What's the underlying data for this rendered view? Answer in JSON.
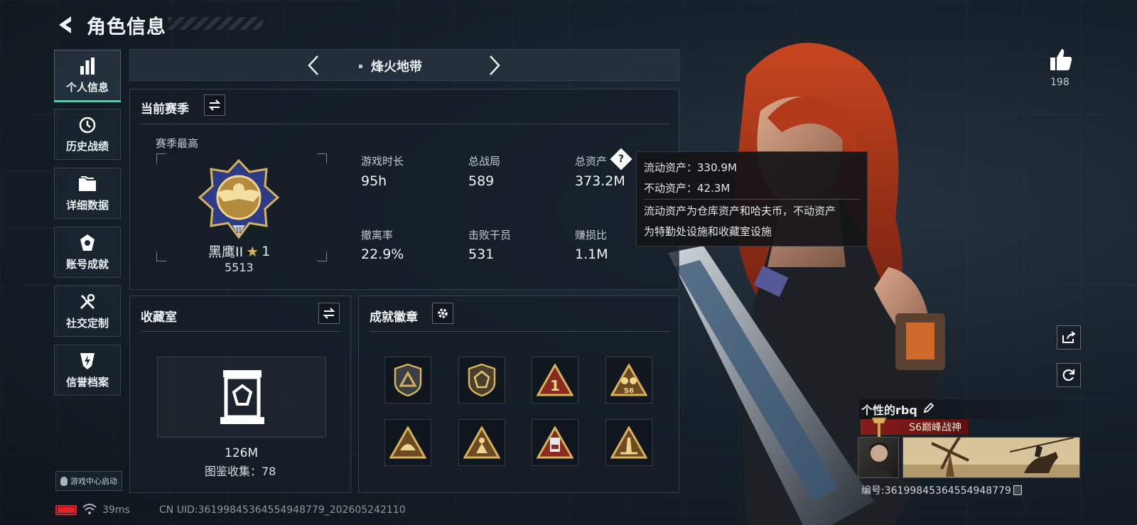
{
  "header": {
    "title": "角色信息"
  },
  "sidebar": {
    "items": [
      {
        "label": "个人信息",
        "icon": "bar-chart-icon",
        "active": true
      },
      {
        "label": "历史战绩",
        "icon": "clock-icon"
      },
      {
        "label": "详细数据",
        "icon": "folder-icon"
      },
      {
        "label": "账号成就",
        "icon": "achievement-icon"
      },
      {
        "label": "社交定制",
        "icon": "tools-icon"
      },
      {
        "label": "信誉档案",
        "icon": "shield-bolt-icon"
      }
    ],
    "game_center_label": "游戏中心启动"
  },
  "mode_selector": {
    "label": "烽火地带"
  },
  "season": {
    "title": "当前赛季",
    "best_label": "赛季最高",
    "rank_name": "黑鹰II",
    "rank_stars": "1",
    "rank_score": "5513",
    "stats": [
      {
        "label": "游戏时长",
        "value": "95h"
      },
      {
        "label": "总战局",
        "value": "589"
      },
      {
        "label": "总资产",
        "value": "373.2M",
        "help": true
      },
      {
        "label": "撤离率",
        "value": "22.9%"
      },
      {
        "label": "击败干员",
        "value": "531"
      },
      {
        "label": "赚损比",
        "value": "1.1M"
      }
    ]
  },
  "tooltip": {
    "liquid": "流动资产：330.9M",
    "fixed": "不动资产：42.3M",
    "desc_line1": "流动资产为仓库资产和哈夫币，不动资产",
    "desc_line2": "为特勤处设施和收藏室设施"
  },
  "collection": {
    "title": "收藏室",
    "value": "126M",
    "count_label": "图鉴收集：78"
  },
  "achievements": {
    "title": "成就徽章",
    "badges": [
      "shield-triangle-badge",
      "shield-gem-badge",
      "triangle-one-badge",
      "triangle-s6-badge",
      "triangle-helmet-badge",
      "triangle-figure-badge",
      "triangle-card-badge",
      "triangle-tower-badge"
    ]
  },
  "status_bar": {
    "ping": "39ms",
    "uid": "CN UID:3619984536455494877​9_202605242110"
  },
  "profile": {
    "likes": "198",
    "name": "个性的rbq",
    "title_badge": "S6巅峰战神",
    "id_label": "编号:361998453645549487​79"
  },
  "colors": {
    "accent": "#2fe0a6",
    "gold": "#d8b25a",
    "battery": "#e0222a",
    "title_badge_bg": "#8a1c1c"
  }
}
